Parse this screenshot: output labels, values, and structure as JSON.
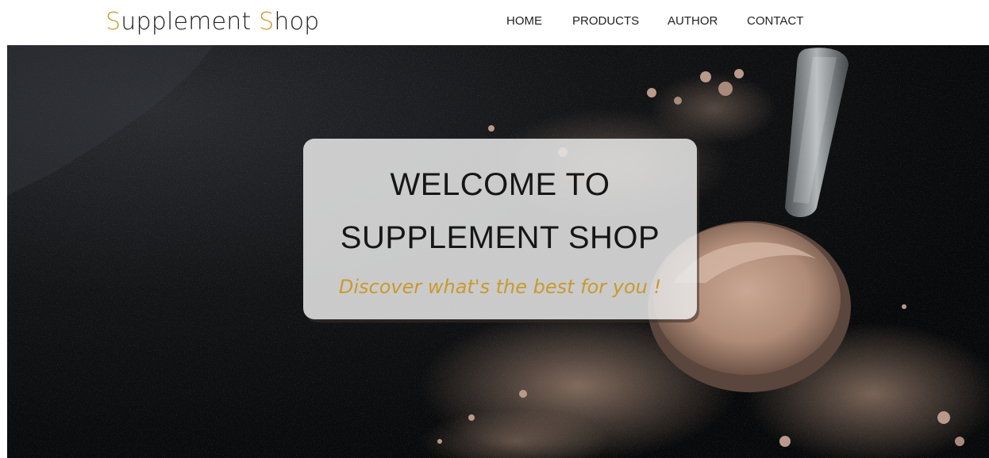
{
  "header": {
    "logo": {
      "first_initial": "S",
      "first_rest": "upplement ",
      "second_initial": "S",
      "second_rest": "hop"
    },
    "nav": [
      {
        "label": "HOME"
      },
      {
        "label": "PRODUCTS"
      },
      {
        "label": "AUTHOR"
      },
      {
        "label": "CONTACT"
      }
    ]
  },
  "hero": {
    "title_line1": "WELCOME TO",
    "title_line2": "SUPPLEMENT SHOP",
    "tagline": "Discover what's the best for you !"
  },
  "colors": {
    "accent": "#c89a2e",
    "text": "#222222",
    "hero_background": "#0d0e10",
    "card_background": "#e9e9e9"
  },
  "icons": [
    "scoop-image",
    "powder-image"
  ]
}
